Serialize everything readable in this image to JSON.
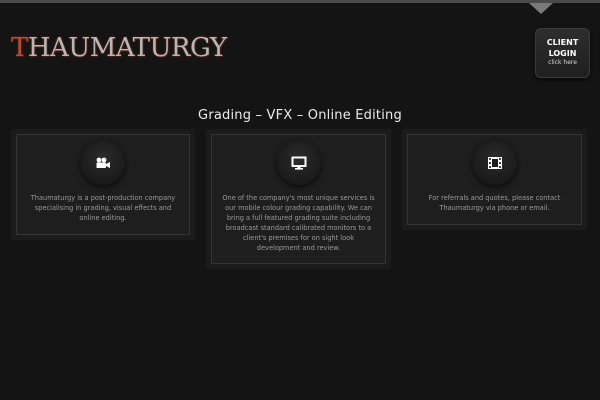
{
  "header": {
    "logo_text": "THAUMATURGY",
    "client_login": {
      "line1": "CLIENT",
      "line2": "LOGIN",
      "line3": "click here"
    }
  },
  "tagline": "Grading – VFX – Online Editing",
  "cards": [
    {
      "icon": "video-camera-icon",
      "text": "Thaumaturgy is a post-production company specialising in grading, visual effects and online editing."
    },
    {
      "icon": "monitor-icon",
      "text": "One of the company's most unique services is our mobile colour grading capability.  We can bring a full featured grading suite including broadcast standard calibrated monitors to a client's premises for on sight look development and review."
    },
    {
      "icon": "film-strip-icon",
      "text": "For referrals and quotes, please contact Thaumaturgy via phone or email."
    }
  ],
  "colors": {
    "background": "#141414",
    "card": "#1e1e1e",
    "logo_accent": "#c44a22"
  }
}
